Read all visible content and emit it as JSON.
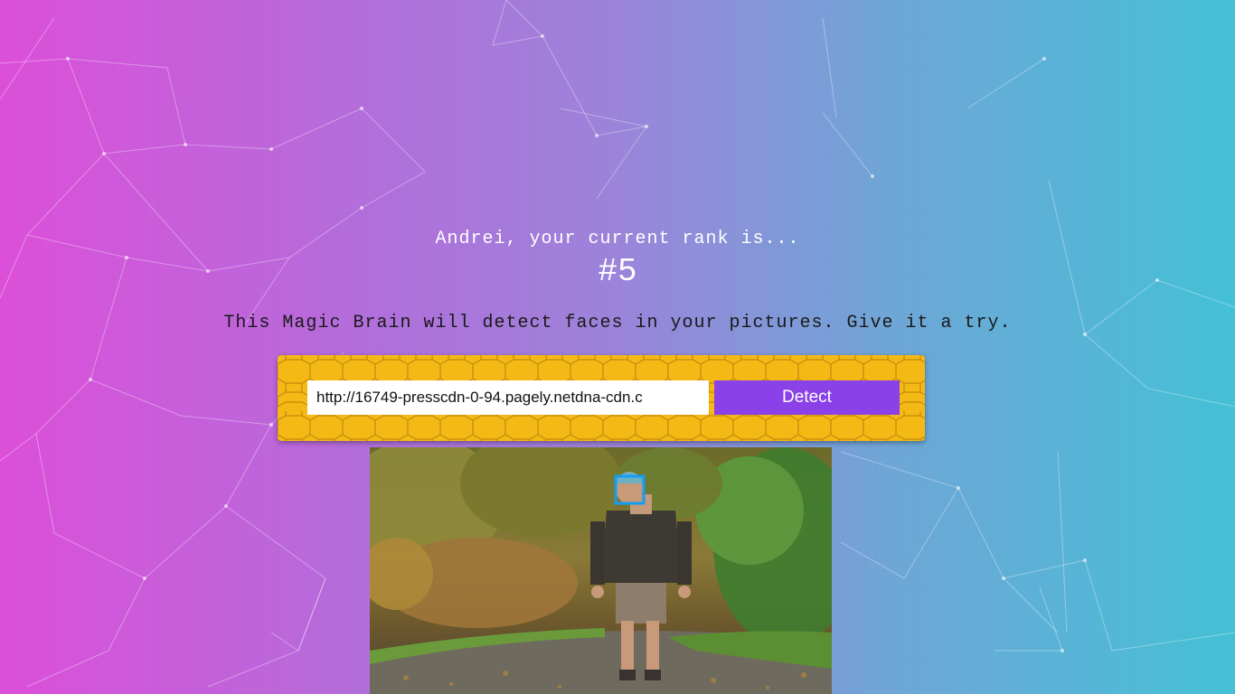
{
  "rank": {
    "caption": "Andrei, your current rank is...",
    "value": "#5"
  },
  "tagline": "This Magic Brain will detect faces in your pictures. Give it a try.",
  "form": {
    "url_value": "http://16749-presscdn-0-94.pagely.netdna-cdn.c",
    "detect_label": "Detect"
  },
  "colors": {
    "background_start": "#dc4fd9",
    "background_end": "#44c0d6",
    "panel": "#f5b916",
    "button": "#8a41e8",
    "face_box": "#149df2"
  },
  "image": {
    "description_icon": "photo-of-man-walking-in-forest"
  }
}
